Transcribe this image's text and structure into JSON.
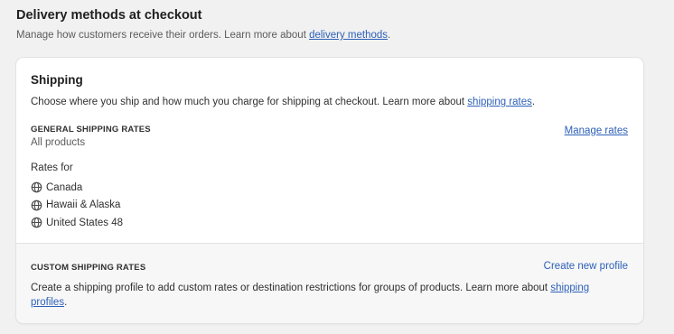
{
  "page": {
    "title": "Delivery methods at checkout",
    "description": "Manage how customers receive their orders. Learn more about ",
    "description_link": "delivery methods",
    "description_end": "."
  },
  "shipping": {
    "heading": "Shipping",
    "description": "Choose where you ship and how much you charge for shipping at checkout. Learn more about ",
    "description_link": "shipping rates",
    "description_end": ".",
    "general": {
      "label": "GENERAL SHIPPING RATES",
      "products": "All products",
      "manage_label": "Manage rates",
      "rates_for": "Rates for",
      "zones": [
        {
          "name": "Canada",
          "icon": "globe-icon"
        },
        {
          "name": "Hawaii & Alaska",
          "icon": "globe-icon"
        },
        {
          "name": "United States 48",
          "icon": "globe-icon"
        }
      ]
    },
    "custom": {
      "label": "CUSTOM SHIPPING RATES",
      "create_label": "Create new profile",
      "description": "Create a shipping profile to add custom rates or destination restrictions for groups of products. Learn more about ",
      "description_link": "shipping profiles",
      "description_end": "."
    }
  },
  "colors": {
    "link": "#2c5fb8",
    "background": "#f1f1f1",
    "card": "#ffffff",
    "card_footer": "#f7f7f7"
  }
}
